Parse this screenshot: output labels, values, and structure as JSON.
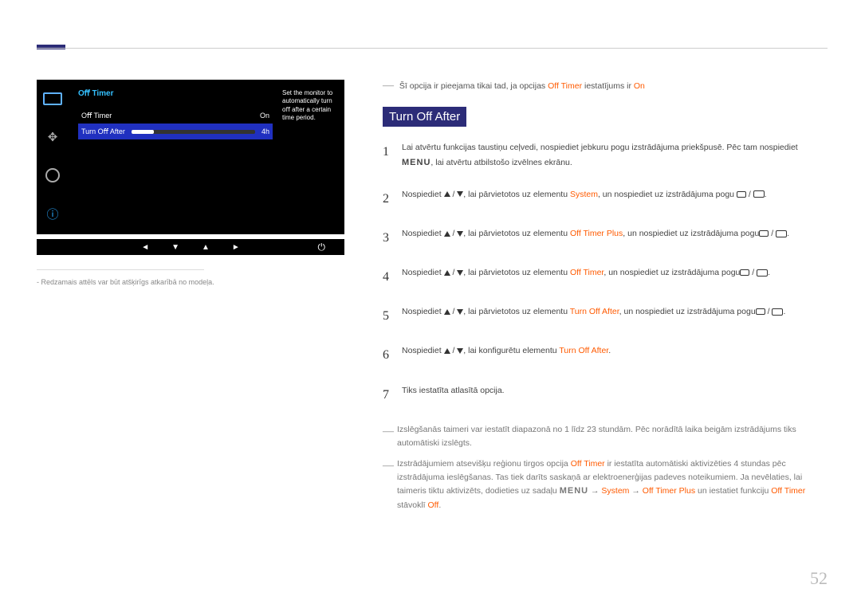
{
  "monitor_menu": {
    "title": "Oﬀ Timer",
    "row1": {
      "label": "Oﬀ Timer",
      "value": "On"
    },
    "row2": {
      "label": "Turn Oﬀ After",
      "value": "4h"
    },
    "help": "Set the monitor to automatically turn oﬀ after a certain time period."
  },
  "caption": "Redzamais attēls var būt atšķirīgs atkarībā no modeļa.",
  "top_note": {
    "pre": "Šī opcija ir pieejama tikai tad, ja opcijas ",
    "h1": "Off Timer",
    "mid": " iestatījums ir ",
    "h2": "On"
  },
  "section_title": "Turn Off After",
  "steps": {
    "s1": {
      "a": "Lai atvērtu funkcijas taustiņu ceļvedi, nospiediet jebkuru pogu izstrādājuma priekšpusē. Pēc tam nospiediet ",
      "menu": "MENU",
      "b": ", lai atvērtu atbilstošo izvēlnes ekrānu."
    },
    "s2": {
      "a": "Nospiediet ",
      "b": ", lai pārvietotos uz elementu ",
      "h": "System",
      "c": ", un nospiediet uz izstrādājuma pogu "
    },
    "s3": {
      "a": "Nospiediet ",
      "b": ", lai pārvietotos uz elementu ",
      "h": "Off Timer Plus",
      "c": ", un nospiediet uz izstrādājuma pogu"
    },
    "s4": {
      "a": "Nospiediet ",
      "b": ", lai pārvietotos uz elementu ",
      "h": "Off Timer",
      "c": ", un nospiediet uz izstrādājuma pogu"
    },
    "s5": {
      "a": "Nospiediet ",
      "b": ", lai pārvietotos uz elementu ",
      "h": "Turn Off After",
      "c": ", un nospiediet uz izstrādājuma pogu"
    },
    "s6": {
      "a": "Nospiediet ",
      "b": ", lai konfigurētu elementu ",
      "h": "Turn Off After",
      "c": "."
    },
    "s7": "Tiks iestatīta atlasītā opcija."
  },
  "foot1": "Izslēgšanās taimeri var iestatīt diapazonā no 1 līdz 23 stundām. Pēc norādītā laika beigām izstrādājums tiks automātiski izslēgts.",
  "foot2": {
    "a": "Izstrādājumiem atsevišķu reģionu tirgos opcija ",
    "h1": "Off Timer",
    "b": " ir iestatīta automātiski aktivizēties 4 stundas pēc izstrādājuma ieslēgšanas. Tas tiek darīts saskaņā ar elektroenerģijas padeves noteikumiem. Ja nevēlaties, lai taimeris tiktu aktivizēts, dodieties uz sadaļu ",
    "menu": "MENU",
    "h2": "System",
    "h3": "Off Timer Plus",
    "c": " un iestatiet funkciju ",
    "h4": "Off Timer",
    "d": " stāvoklī ",
    "h5": "Off",
    "e": "."
  },
  "page_number": "52"
}
